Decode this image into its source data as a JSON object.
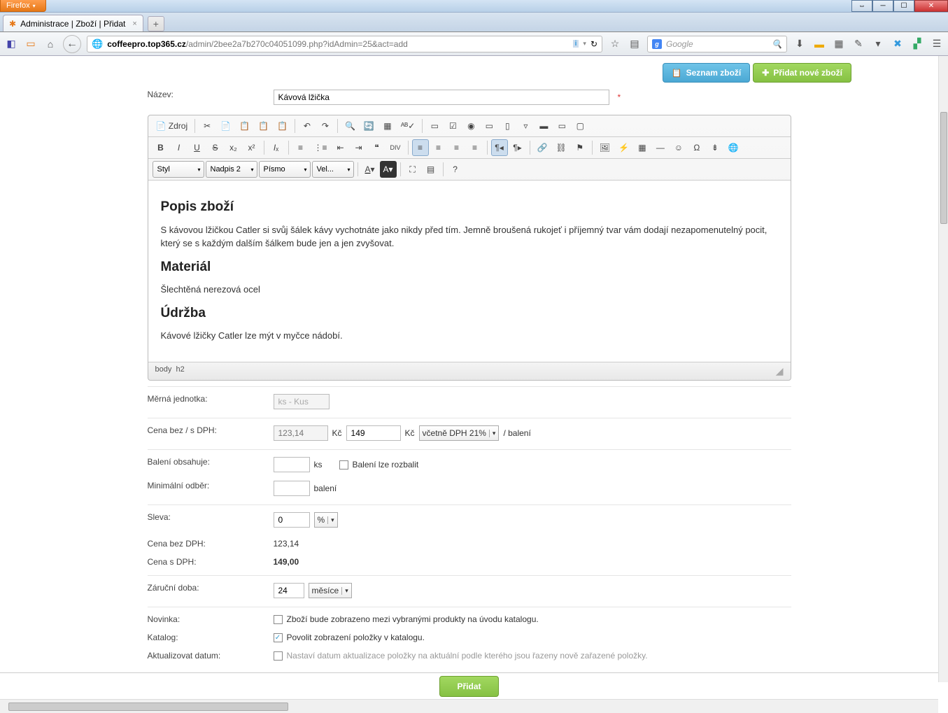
{
  "browser": {
    "name": "Firefox",
    "tab_title": "Administrace | Zboží | Přidat",
    "url_domain": "coffeepro.top365.cz",
    "url_path": "/admin/2bee2a7b270c04051099.php?idAdmin=25&act=add",
    "search_placeholder": "Google"
  },
  "topbar": {
    "list_btn": "Seznam zboží",
    "add_btn": "Přidat nové zboží"
  },
  "labels": {
    "nazev": "Název:",
    "merna": "Měrná jednotka:",
    "cena_dph": "Cena bez / s DPH:",
    "baleni": "Balení obsahuje:",
    "min_odber": "Minimální odběr:",
    "sleva": "Sleva:",
    "cena_bez": "Cena bez DPH:",
    "cena_s": "Cena s DPH:",
    "zarucni": "Záruční doba:",
    "novinka": "Novinka:",
    "katalog": "Katalog:",
    "aktual": "Aktualizovat datum:"
  },
  "values": {
    "nazev": "Kávová lžička",
    "merna": "ks - Kus",
    "cena_bez_ph": "123,14",
    "cena_s_val": "149",
    "kc": "Kč",
    "dph_sel": "včetně DPH 21%",
    "per_baleni": "/ balení",
    "ks": "ks",
    "baleni_chk": "Balení lze rozbalit",
    "baleni_unit": "balení",
    "sleva_val": "0",
    "sleva_unit": "%",
    "cena_bez_out": "123,14",
    "cena_s_out": "149,00",
    "zarucni_val": "24",
    "zarucni_unit": "měsíce",
    "novinka_txt": "Zboží bude zobrazeno mezi vybranými produkty na úvodu katalogu.",
    "katalog_txt": "Povolit zobrazení položky v katalogu.",
    "aktual_txt": "Nastaví datum aktualizace položky na aktuální podle kterého jsou řazeny nově zařazené položky."
  },
  "editor": {
    "src": "Zdroj",
    "styl": "Styl",
    "format": "Nadpis 2",
    "font": "Písmo",
    "size": "Vel...",
    "path1": "body",
    "path2": "h2",
    "content": {
      "h1": "Popis zboží",
      "p1": "S kávovou lžičkou Catler si svůj šálek kávy vychotnáte jako nikdy před tím. Jemně broušená rukojeť i příjemný tvar vám dodají nezapomenutelný pocit, který se s každým dalším šálkem bude jen a jen zvyšovat.",
      "h2": "Materiál",
      "p2": "Šlechtěná nerezová ocel",
      "h3": "Údržba",
      "p3": "Kávové lžičky Catler lze mýt v myčce nádobí."
    }
  },
  "footer": {
    "submit": "Přidat"
  }
}
